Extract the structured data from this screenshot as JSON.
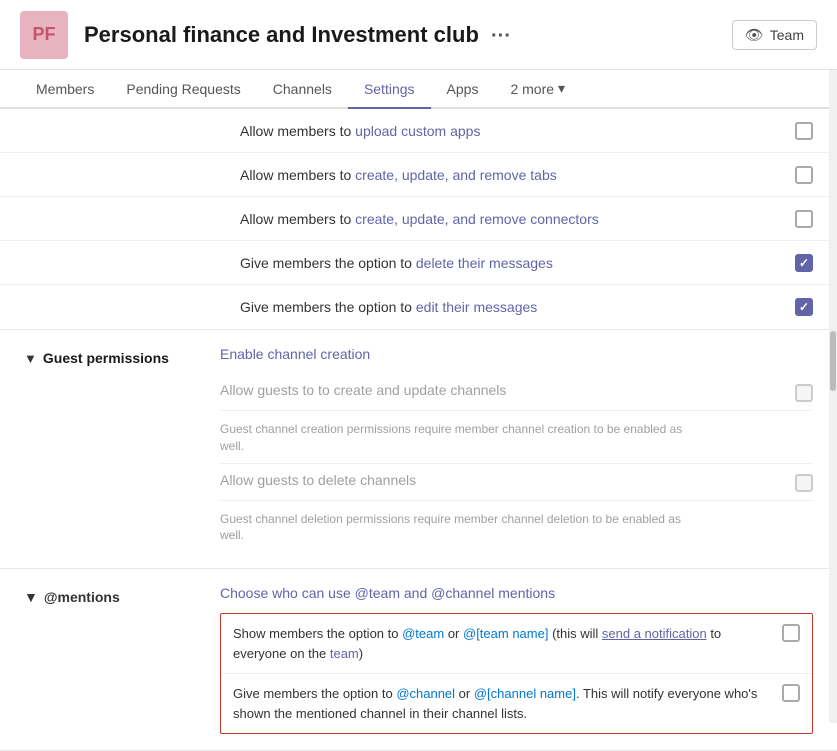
{
  "header": {
    "avatar_text": "PF",
    "title": "Personal finance and Investment club",
    "dots": "···",
    "team_label": "Team"
  },
  "nav": {
    "tabs": [
      {
        "id": "members",
        "label": "Members",
        "active": false
      },
      {
        "id": "pending",
        "label": "Pending Requests",
        "active": false
      },
      {
        "id": "channels",
        "label": "Channels",
        "active": false
      },
      {
        "id": "settings",
        "label": "Settings",
        "active": true
      },
      {
        "id": "apps",
        "label": "Apps",
        "active": false
      },
      {
        "id": "more",
        "label": "2 more",
        "active": false,
        "has_arrow": true
      }
    ]
  },
  "settings": {
    "member_permissions_rows": [
      {
        "id": "upload-custom-apps",
        "text_before": "Allow members to ",
        "text_highlight": "upload custom apps",
        "text_after": "",
        "checked": false,
        "disabled": false
      },
      {
        "id": "create-update-remove-tabs",
        "text_before": "Allow members to ",
        "text_highlight": "create, update, and remove tabs",
        "text_after": "",
        "checked": false,
        "disabled": false
      },
      {
        "id": "create-update-remove-connectors",
        "text_before": "Allow members to ",
        "text_highlight": "create, update, and remove connectors",
        "text_after": "",
        "checked": false,
        "disabled": false
      },
      {
        "id": "delete-messages",
        "text_before": "Give members the option to ",
        "text_highlight": "delete their messages",
        "text_after": "",
        "checked": true,
        "disabled": false
      },
      {
        "id": "edit-messages",
        "text_before": "Give members the option to ",
        "text_highlight": "edit their messages",
        "text_after": "",
        "checked": true,
        "disabled": false
      }
    ],
    "guest_permissions": {
      "section_title": "Guest permissions",
      "link": "Enable channel creation",
      "rows": [
        {
          "id": "guests-create-update-channels",
          "main_text": "Allow guests to to create and update channels",
          "sub_text": "",
          "checked": false,
          "disabled": true
        },
        {
          "id": "guests-create-update-note",
          "main_text": "",
          "sub_text": "Guest channel creation permissions require member channel creation to be enabled as well.",
          "is_note": true
        },
        {
          "id": "guests-delete-channels",
          "main_text": "Allow guests to delete channels",
          "sub_text": "",
          "checked": false,
          "disabled": true
        },
        {
          "id": "guests-delete-note",
          "main_text": "",
          "sub_text": "Guest channel deletion permissions require member channel deletion to be enabled as well.",
          "is_note": true
        }
      ]
    },
    "mentions": {
      "section_title": "@mentions",
      "subtitle": "Choose who can use @team and @channel mentions",
      "rows": [
        {
          "id": "team-mentions",
          "text": "Show members the option to @team or @[team name] (this will send a notification to everyone on the team)",
          "checked": false
        },
        {
          "id": "channel-mentions",
          "text": "Give members the option to @channel or @[channel name]. This will notify everyone who's shown the mentioned channel in their channel lists.",
          "checked": false
        }
      ]
    }
  }
}
